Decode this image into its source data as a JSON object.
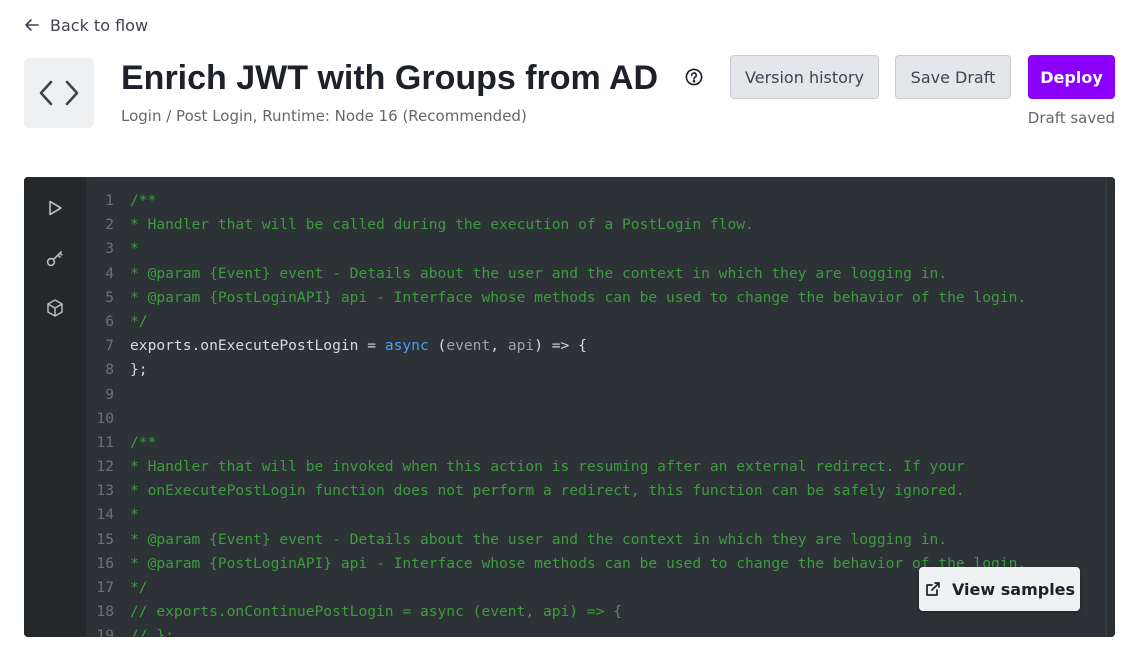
{
  "nav": {
    "back_label": "Back to flow"
  },
  "header": {
    "title": "Enrich JWT with Groups from AD",
    "subtitle": "Login / Post Login, Runtime: Node 16 (Recommended)",
    "help_icon": "question-circle-icon",
    "version_history_label": "Version history",
    "save_draft_label": "Save Draft",
    "deploy_label": "Deploy",
    "draft_status": "Draft saved"
  },
  "colors": {
    "accent": "#8a00fb",
    "editor_bg": "#2d3236",
    "comment": "#3d9c3e",
    "keyword": "#4a9ff5"
  },
  "editor": {
    "sidebar_icons": [
      "play-icon",
      "key-icon",
      "package-icon"
    ],
    "lines": [
      {
        "n": "1",
        "segs": [
          {
            "t": "/**",
            "c": "comment"
          }
        ]
      },
      {
        "n": "2",
        "segs": [
          {
            "t": "* Handler that will be called during the execution of a PostLogin flow.",
            "c": "comment"
          }
        ]
      },
      {
        "n": "3",
        "segs": [
          {
            "t": "*",
            "c": "comment"
          }
        ]
      },
      {
        "n": "4",
        "segs": [
          {
            "t": "* @param {Event} event - Details about the user and the context in which they are logging in.",
            "c": "comment"
          }
        ]
      },
      {
        "n": "5",
        "segs": [
          {
            "t": "* @param {PostLoginAPI} api - Interface whose methods can be used to change the behavior of the login.",
            "c": "comment"
          }
        ]
      },
      {
        "n": "6",
        "segs": [
          {
            "t": "*/",
            "c": "comment"
          }
        ]
      },
      {
        "n": "7",
        "segs": [
          {
            "t": "exports.onExecutePostLogin = ",
            "c": "plain"
          },
          {
            "t": "async",
            "c": "kw"
          },
          {
            "t": " (",
            "c": "plain"
          },
          {
            "t": "event",
            "c": "param"
          },
          {
            "t": ", ",
            "c": "plain"
          },
          {
            "t": "api",
            "c": "param"
          },
          {
            "t": ") => {",
            "c": "plain"
          }
        ]
      },
      {
        "n": "8",
        "segs": [
          {
            "t": "};",
            "c": "plain"
          }
        ]
      },
      {
        "n": "9",
        "segs": []
      },
      {
        "n": "10",
        "segs": []
      },
      {
        "n": "11",
        "segs": [
          {
            "t": "/**",
            "c": "comment"
          }
        ]
      },
      {
        "n": "12",
        "segs": [
          {
            "t": "* Handler that will be invoked when this action is resuming after an external redirect. If your",
            "c": "comment"
          }
        ]
      },
      {
        "n": "13",
        "segs": [
          {
            "t": "* onExecutePostLogin function does not perform a redirect, this function can be safely ignored.",
            "c": "comment"
          }
        ]
      },
      {
        "n": "14",
        "segs": [
          {
            "t": "*",
            "c": "comment"
          }
        ]
      },
      {
        "n": "15",
        "segs": [
          {
            "t": "* @param {Event} event - Details about the user and the context in which they are logging in.",
            "c": "comment"
          }
        ]
      },
      {
        "n": "16",
        "segs": [
          {
            "t": "* @param {PostLoginAPI} api - Interface whose methods can be used to change the behavior of the login.",
            "c": "comment"
          }
        ]
      },
      {
        "n": "17",
        "segs": [
          {
            "t": "*/",
            "c": "comment"
          }
        ]
      },
      {
        "n": "18",
        "segs": [
          {
            "t": "// exports.onContinuePostLogin = async (event, api) => {",
            "c": "comment"
          }
        ]
      },
      {
        "n": "19",
        "segs": [
          {
            "t": "// };",
            "c": "comment"
          }
        ]
      }
    ],
    "view_samples_label": "View samples",
    "view_samples_icon": "external-link-icon"
  }
}
